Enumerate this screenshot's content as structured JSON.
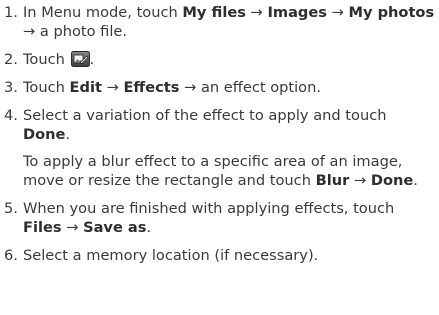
{
  "steps": [
    {
      "num": "1.",
      "t1": "In Menu mode, touch ",
      "b1": "My files",
      "t2": " → ",
      "b2": "Images",
      "t3": " → ",
      "b3": "My photos",
      "t4": " → a photo file."
    },
    {
      "num": "2.",
      "t1": "Touch ",
      "icon": "edit-photo-icon",
      "t2": "."
    },
    {
      "num": "3.",
      "t1": "Touch ",
      "b1": "Edit",
      "t2": " → ",
      "b2": "Effects",
      "t3": " → an effect option."
    },
    {
      "num": "4.",
      "t1": "Select a variation of the effect to apply and touch ",
      "b1": "Done",
      "t2": ".",
      "sub": {
        "t1": "To apply a blur effect to a specific area of an image, move or resize the rectangle and touch ",
        "b1": "Blur",
        "t2": " → ",
        "b2": "Done",
        "t3": "."
      }
    },
    {
      "num": "5.",
      "t1": "When you are finished with applying effects, touch ",
      "b1": "Files",
      "t2": " → ",
      "b2": "Save as",
      "t3": "."
    },
    {
      "num": "6.",
      "t1": "Select a memory location (if necessary)."
    }
  ]
}
